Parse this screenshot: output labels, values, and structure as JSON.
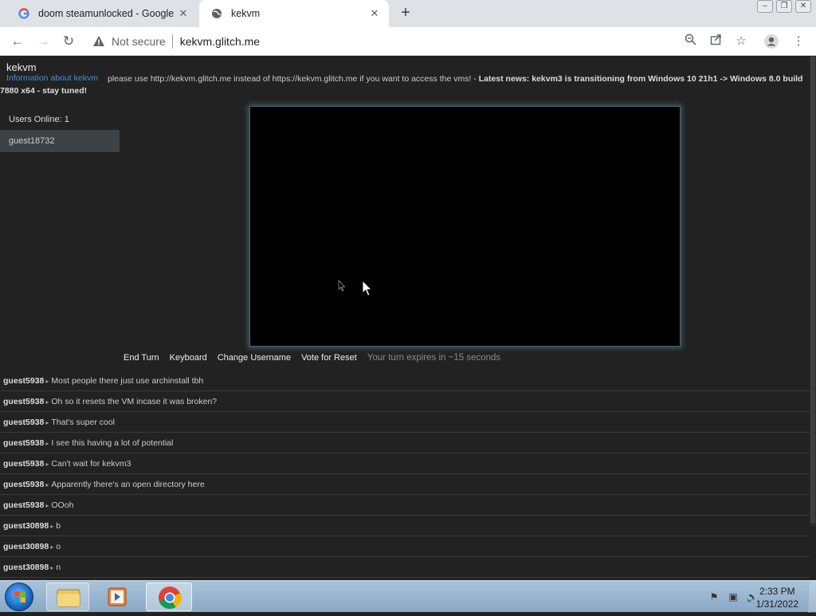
{
  "browser": {
    "tabs": [
      {
        "title": "doom steamunlocked - Google S",
        "favicon": "google-icon",
        "close": "✕"
      },
      {
        "title": "kekvm",
        "favicon": "globe-icon",
        "close": "✕"
      }
    ],
    "new_tab": "+",
    "security_label": "Not secure",
    "url": "kekvm.glitch.me"
  },
  "page": {
    "brand": "kekvm",
    "info_link": "Information about kekvm",
    "notice_text": "please use http://kekvm.glitch.me instead of https://kekvm.glitch.me if you want to access the vms! - ",
    "notice_bold": "Latest news: kekvm3 is transitioning from Windows 10 21h1 -> Windows 8.0 build 7880 x64 - stay tuned!",
    "users_online": "Users Online: 1",
    "users": [
      "guest18732"
    ],
    "vm_buttons": {
      "end_turn": "End Turn",
      "keyboard": "Keyboard",
      "change_username": "Change Username",
      "vote_reset": "Vote for Reset",
      "turn_status": "Your turn expires in ~15 seconds"
    },
    "chat": [
      {
        "user": "guest5938",
        "text": "Most people there just use archinstall tbh"
      },
      {
        "user": "guest5938",
        "text": "Oh so it resets the VM incase it was broken?"
      },
      {
        "user": "guest5938",
        "text": "That's super cool"
      },
      {
        "user": "guest5938",
        "text": "I see this having a lot of potential"
      },
      {
        "user": "guest5938",
        "text": "Can't wait for kekvm3"
      },
      {
        "user": "guest5938",
        "text": "Apparently there's an open directory here"
      },
      {
        "user": "guest5938",
        "text": "OOoh"
      },
      {
        "user": "guest30898",
        "text": "b"
      },
      {
        "user": "guest30898",
        "text": "o"
      },
      {
        "user": "guest30898",
        "text": "n"
      }
    ]
  },
  "taskbar": {
    "time": "2:33 PM",
    "date": "1/31/2022",
    "apps": [
      "folder-icon",
      "media-player-icon",
      "chrome-icon"
    ]
  },
  "colors": {
    "page_bg": "#222222",
    "link": "#4a8fd9",
    "vm_glow": "#4c8492"
  }
}
